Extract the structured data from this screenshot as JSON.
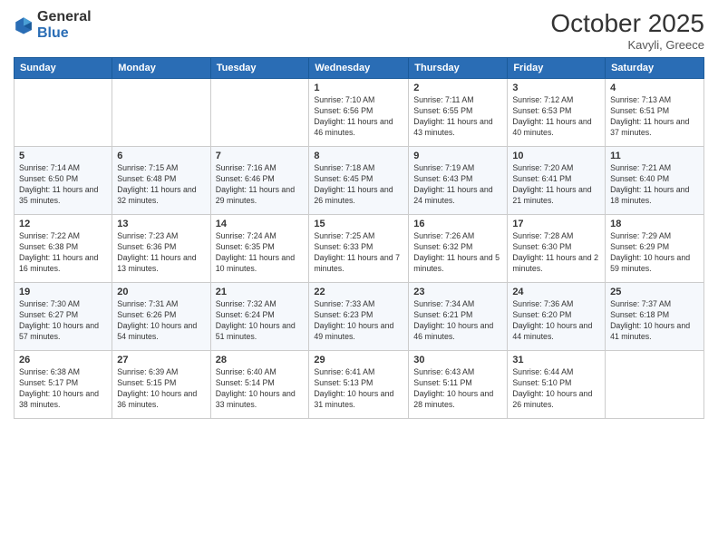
{
  "header": {
    "logo_general": "General",
    "logo_blue": "Blue",
    "month": "October 2025",
    "location": "Kavyli, Greece"
  },
  "weekdays": [
    "Sunday",
    "Monday",
    "Tuesday",
    "Wednesday",
    "Thursday",
    "Friday",
    "Saturday"
  ],
  "weeks": [
    [
      {
        "day": "",
        "info": ""
      },
      {
        "day": "",
        "info": ""
      },
      {
        "day": "",
        "info": ""
      },
      {
        "day": "1",
        "info": "Sunrise: 7:10 AM\nSunset: 6:56 PM\nDaylight: 11 hours and 46 minutes."
      },
      {
        "day": "2",
        "info": "Sunrise: 7:11 AM\nSunset: 6:55 PM\nDaylight: 11 hours and 43 minutes."
      },
      {
        "day": "3",
        "info": "Sunrise: 7:12 AM\nSunset: 6:53 PM\nDaylight: 11 hours and 40 minutes."
      },
      {
        "day": "4",
        "info": "Sunrise: 7:13 AM\nSunset: 6:51 PM\nDaylight: 11 hours and 37 minutes."
      }
    ],
    [
      {
        "day": "5",
        "info": "Sunrise: 7:14 AM\nSunset: 6:50 PM\nDaylight: 11 hours and 35 minutes."
      },
      {
        "day": "6",
        "info": "Sunrise: 7:15 AM\nSunset: 6:48 PM\nDaylight: 11 hours and 32 minutes."
      },
      {
        "day": "7",
        "info": "Sunrise: 7:16 AM\nSunset: 6:46 PM\nDaylight: 11 hours and 29 minutes."
      },
      {
        "day": "8",
        "info": "Sunrise: 7:18 AM\nSunset: 6:45 PM\nDaylight: 11 hours and 26 minutes."
      },
      {
        "day": "9",
        "info": "Sunrise: 7:19 AM\nSunset: 6:43 PM\nDaylight: 11 hours and 24 minutes."
      },
      {
        "day": "10",
        "info": "Sunrise: 7:20 AM\nSunset: 6:41 PM\nDaylight: 11 hours and 21 minutes."
      },
      {
        "day": "11",
        "info": "Sunrise: 7:21 AM\nSunset: 6:40 PM\nDaylight: 11 hours and 18 minutes."
      }
    ],
    [
      {
        "day": "12",
        "info": "Sunrise: 7:22 AM\nSunset: 6:38 PM\nDaylight: 11 hours and 16 minutes."
      },
      {
        "day": "13",
        "info": "Sunrise: 7:23 AM\nSunset: 6:36 PM\nDaylight: 11 hours and 13 minutes."
      },
      {
        "day": "14",
        "info": "Sunrise: 7:24 AM\nSunset: 6:35 PM\nDaylight: 11 hours and 10 minutes."
      },
      {
        "day": "15",
        "info": "Sunrise: 7:25 AM\nSunset: 6:33 PM\nDaylight: 11 hours and 7 minutes."
      },
      {
        "day": "16",
        "info": "Sunrise: 7:26 AM\nSunset: 6:32 PM\nDaylight: 11 hours and 5 minutes."
      },
      {
        "day": "17",
        "info": "Sunrise: 7:28 AM\nSunset: 6:30 PM\nDaylight: 11 hours and 2 minutes."
      },
      {
        "day": "18",
        "info": "Sunrise: 7:29 AM\nSunset: 6:29 PM\nDaylight: 10 hours and 59 minutes."
      }
    ],
    [
      {
        "day": "19",
        "info": "Sunrise: 7:30 AM\nSunset: 6:27 PM\nDaylight: 10 hours and 57 minutes."
      },
      {
        "day": "20",
        "info": "Sunrise: 7:31 AM\nSunset: 6:26 PM\nDaylight: 10 hours and 54 minutes."
      },
      {
        "day": "21",
        "info": "Sunrise: 7:32 AM\nSunset: 6:24 PM\nDaylight: 10 hours and 51 minutes."
      },
      {
        "day": "22",
        "info": "Sunrise: 7:33 AM\nSunset: 6:23 PM\nDaylight: 10 hours and 49 minutes."
      },
      {
        "day": "23",
        "info": "Sunrise: 7:34 AM\nSunset: 6:21 PM\nDaylight: 10 hours and 46 minutes."
      },
      {
        "day": "24",
        "info": "Sunrise: 7:36 AM\nSunset: 6:20 PM\nDaylight: 10 hours and 44 minutes."
      },
      {
        "day": "25",
        "info": "Sunrise: 7:37 AM\nSunset: 6:18 PM\nDaylight: 10 hours and 41 minutes."
      }
    ],
    [
      {
        "day": "26",
        "info": "Sunrise: 6:38 AM\nSunset: 5:17 PM\nDaylight: 10 hours and 38 minutes."
      },
      {
        "day": "27",
        "info": "Sunrise: 6:39 AM\nSunset: 5:15 PM\nDaylight: 10 hours and 36 minutes."
      },
      {
        "day": "28",
        "info": "Sunrise: 6:40 AM\nSunset: 5:14 PM\nDaylight: 10 hours and 33 minutes."
      },
      {
        "day": "29",
        "info": "Sunrise: 6:41 AM\nSunset: 5:13 PM\nDaylight: 10 hours and 31 minutes."
      },
      {
        "day": "30",
        "info": "Sunrise: 6:43 AM\nSunset: 5:11 PM\nDaylight: 10 hours and 28 minutes."
      },
      {
        "day": "31",
        "info": "Sunrise: 6:44 AM\nSunset: 5:10 PM\nDaylight: 10 hours and 26 minutes."
      },
      {
        "day": "",
        "info": ""
      }
    ]
  ]
}
